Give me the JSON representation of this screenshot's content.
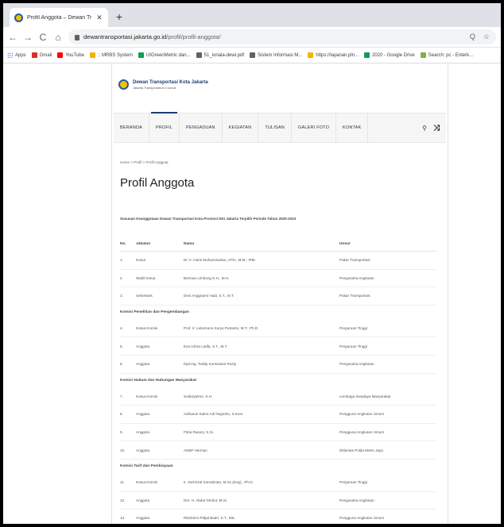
{
  "browser": {
    "tab_title": "Profil Anggota – Dewan Transportasi Kota Jakarta",
    "tab_close": "✕",
    "new_tab": "+",
    "nav": {
      "back": "←",
      "forward": "→",
      "reload": "C",
      "home": "⌂"
    },
    "url_host": "dewantransportasi.jakarta.go.id",
    "url_path": "/profil/profil-anggota/",
    "omnibox_icons": {
      "search": "Q",
      "star": "☆"
    },
    "bookmarks": [
      {
        "label": "Apps",
        "icon": "apps-grid-icon",
        "color": "#1a73e8"
      },
      {
        "label": "Gmail",
        "icon": "gmail-icon",
        "color": "#d93025"
      },
      {
        "label": "YouTube",
        "icon": "youtube-icon",
        "color": "#ff0000"
      },
      {
        "label": ":: MRBS System",
        "icon": "mrbs-icon",
        "color": "#f4b400"
      },
      {
        "label": "UIGreenMetric dan...",
        "icon": "drive-icon",
        "color": "#0f9d58"
      },
      {
        "label": "51_ionala-dewi.pdf",
        "icon": "globe-icon",
        "color": "#5f6368"
      },
      {
        "label": "Sistem Informasi M...",
        "icon": "globe-icon",
        "color": "#5f6368"
      },
      {
        "label": "https://layanan.pln...",
        "icon": "pln-icon",
        "color": "#f4b400"
      },
      {
        "label": "2020 - Google Drive",
        "icon": "drive-icon",
        "color": "#0f9d58"
      },
      {
        "label": "Search: pc - Enterk...",
        "icon": "search-bookmark-icon",
        "color": "#7cb342"
      }
    ]
  },
  "site": {
    "brand_name": "Dewan Transportasi Kota Jakarta",
    "brand_sub": "Jakarta Transportation Council",
    "menu": [
      "BERANDA",
      "PROFIL",
      "PENGADUAN",
      "KEGIATAN",
      "TULISAN",
      "GALERI FOTO",
      "KONTAK"
    ],
    "active_menu": "PROFIL",
    "menu_icons": {
      "search": "⚲",
      "shuffle": "⤨"
    },
    "breadcrumb": "Home > Profil > Profil Anggota",
    "page_title": "Profil Anggota",
    "subheading": "Susunan Keanggotaan Dewan Transportasi Kota Provinsi DKI Jakarta Terpilih Periode Tahun 2020-2023",
    "table_headers": {
      "no": "No.",
      "jabatan": "Jabatan",
      "nama": "Nama",
      "unsur": "Unsur"
    },
    "rows": [
      {
        "type": "row",
        "no": "1.",
        "jabatan": "Ketua",
        "nama": "Dr. Ir. Haris Muhammadun, ATD., M.M., IPM.",
        "unsur": "Pakar Transportasi"
      },
      {
        "type": "row",
        "no": "2.",
        "jabatan": "Wakil Ketua",
        "nama": "Berman Limbong S.H., M.H.",
        "unsur": "Pengusaha Angkutan"
      },
      {
        "type": "row",
        "no": "3.",
        "jabatan": "Sekretaris",
        "nama": "Devi Anggraeni Hadi, S.T., M.T.",
        "unsur": "Pakar Transportasi"
      },
      {
        "type": "section",
        "title": "Komisi Penelitian dan Pengembangan"
      },
      {
        "type": "row",
        "no": "4.",
        "jabatan": "Ketua Komisi",
        "nama": "Prof. Ir. Leksmono Suryo Putranto, M.T., Ph.D.",
        "unsur": "Perguruan Tinggi"
      },
      {
        "type": "row",
        "no": "5.",
        "jabatan": "Anggota",
        "nama": "Eva Azhra Latifa, S.T., M.T.",
        "unsur": "Perguruan Tinggi"
      },
      {
        "type": "row",
        "no": "6.",
        "jabatan": "Anggota",
        "nama": "Dipl.Ing. Teddy Kurniawan Rusly",
        "unsur": "Pengusaha Angkutan"
      },
      {
        "type": "section",
        "title": "Komisi Hukum dan Hubungan Masyarakat"
      },
      {
        "type": "row",
        "no": "7.",
        "jabatan": "Ketua Komisi",
        "nama": "Sudaryatmo, S.H.",
        "unsur": "Lembaga Swadaya Masyarakat"
      },
      {
        "type": "row",
        "no": "8.",
        "jabatan": "Anggota",
        "nama": "Adrianus Satrio Adi Nugroho, S.Kom.",
        "unsur": "Pengguna Angkutan Umum"
      },
      {
        "type": "row",
        "no": "9.",
        "jabatan": "Anggota",
        "nama": "Fitria Rasory, S.Si.",
        "unsur": "Pengguna Angkutan Umum"
      },
      {
        "type": "row",
        "no": "10.",
        "jabatan": "Anggota",
        "nama": "AKBP Herman",
        "unsur": "Ditlantas Polda Metro Jaya"
      },
      {
        "type": "section",
        "title": "Komisi Tarif dan Pembiayaan"
      },
      {
        "type": "row",
        "no": "11.",
        "jabatan": "Ketua Komisi",
        "nama": "Ir. Jachrizal Sumabrata, M.Sc.(Eng)., Ph.D.",
        "unsur": "Perguruan Tinggi"
      },
      {
        "type": "row",
        "no": "12.",
        "jabatan": "Anggota",
        "nama": "Drs. H. Abdul Ghofur, M.Si.",
        "unsur": "Pengusaha Angkutan"
      },
      {
        "type": "row",
        "no": "13.",
        "jabatan": "Anggota",
        "nama": "Rikobimo Ridjal Badri, S.T., MIL",
        "unsur": "Pengguna Angkutan Umum"
      }
    ]
  }
}
